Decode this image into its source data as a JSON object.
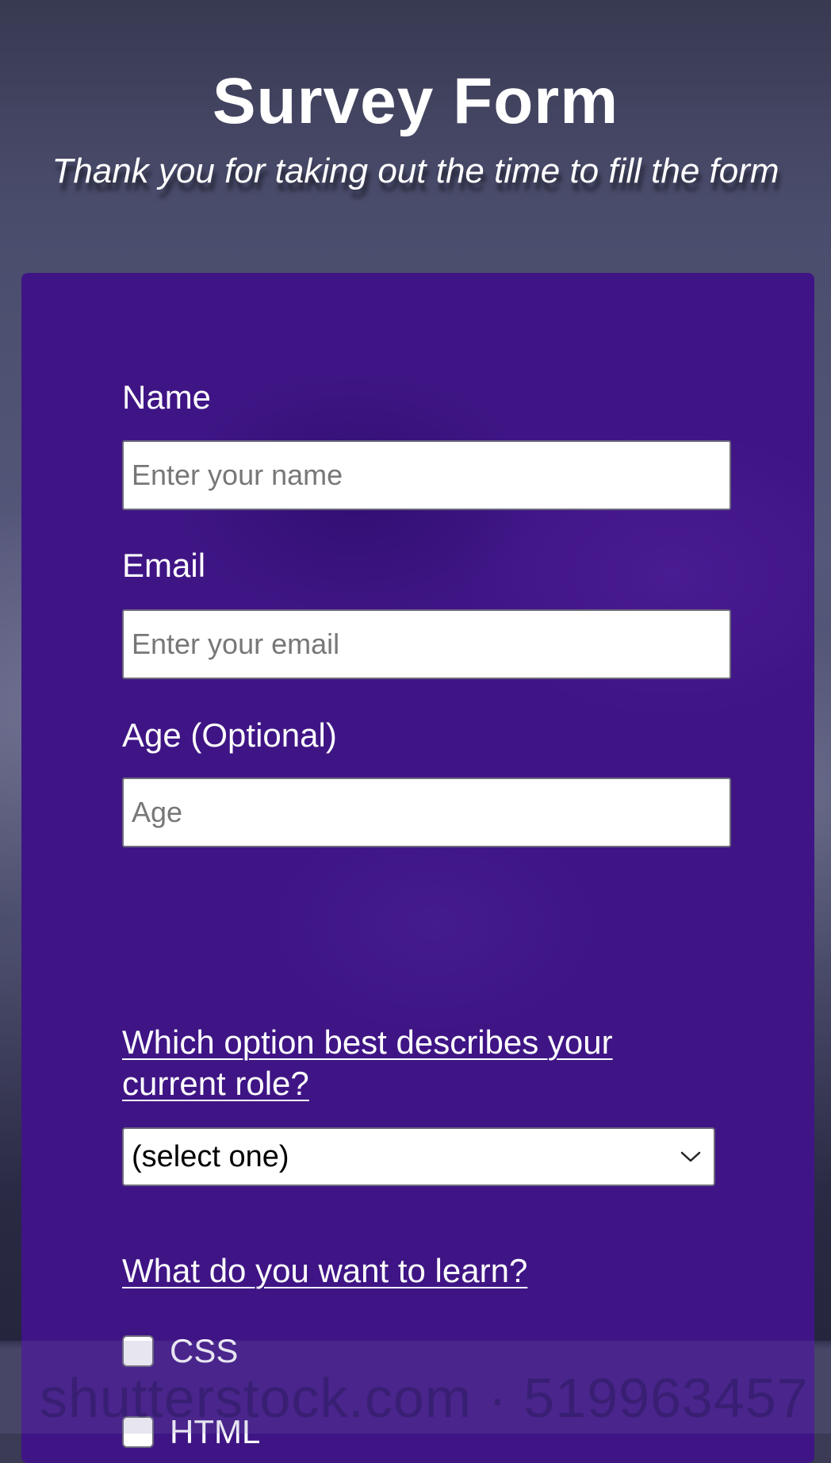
{
  "header": {
    "title": "Survey Form",
    "subtitle": "Thank you for taking out the time to fill the form"
  },
  "form": {
    "name": {
      "label": "Name",
      "placeholder": "Enter your name",
      "value": ""
    },
    "email": {
      "label": "Email",
      "placeholder": "Enter your email",
      "value": ""
    },
    "age": {
      "label": "Age (Optional)",
      "placeholder": "Age",
      "value": ""
    },
    "role": {
      "question": "Which option best describes your current role?",
      "selected": "(select one)",
      "icon": "chevron-down-icon"
    },
    "learn": {
      "question": "What do you want to learn?",
      "options": [
        {
          "label": "CSS",
          "checked": false
        },
        {
          "label": "HTML",
          "checked": false
        }
      ]
    }
  },
  "watermark": {
    "text": "shutterstock.com · 519963457"
  },
  "colors": {
    "card_background": "#3f1585",
    "page_background": "#4a4c6c",
    "text": "#ffffff",
    "input_border": "#6d6a7c"
  }
}
